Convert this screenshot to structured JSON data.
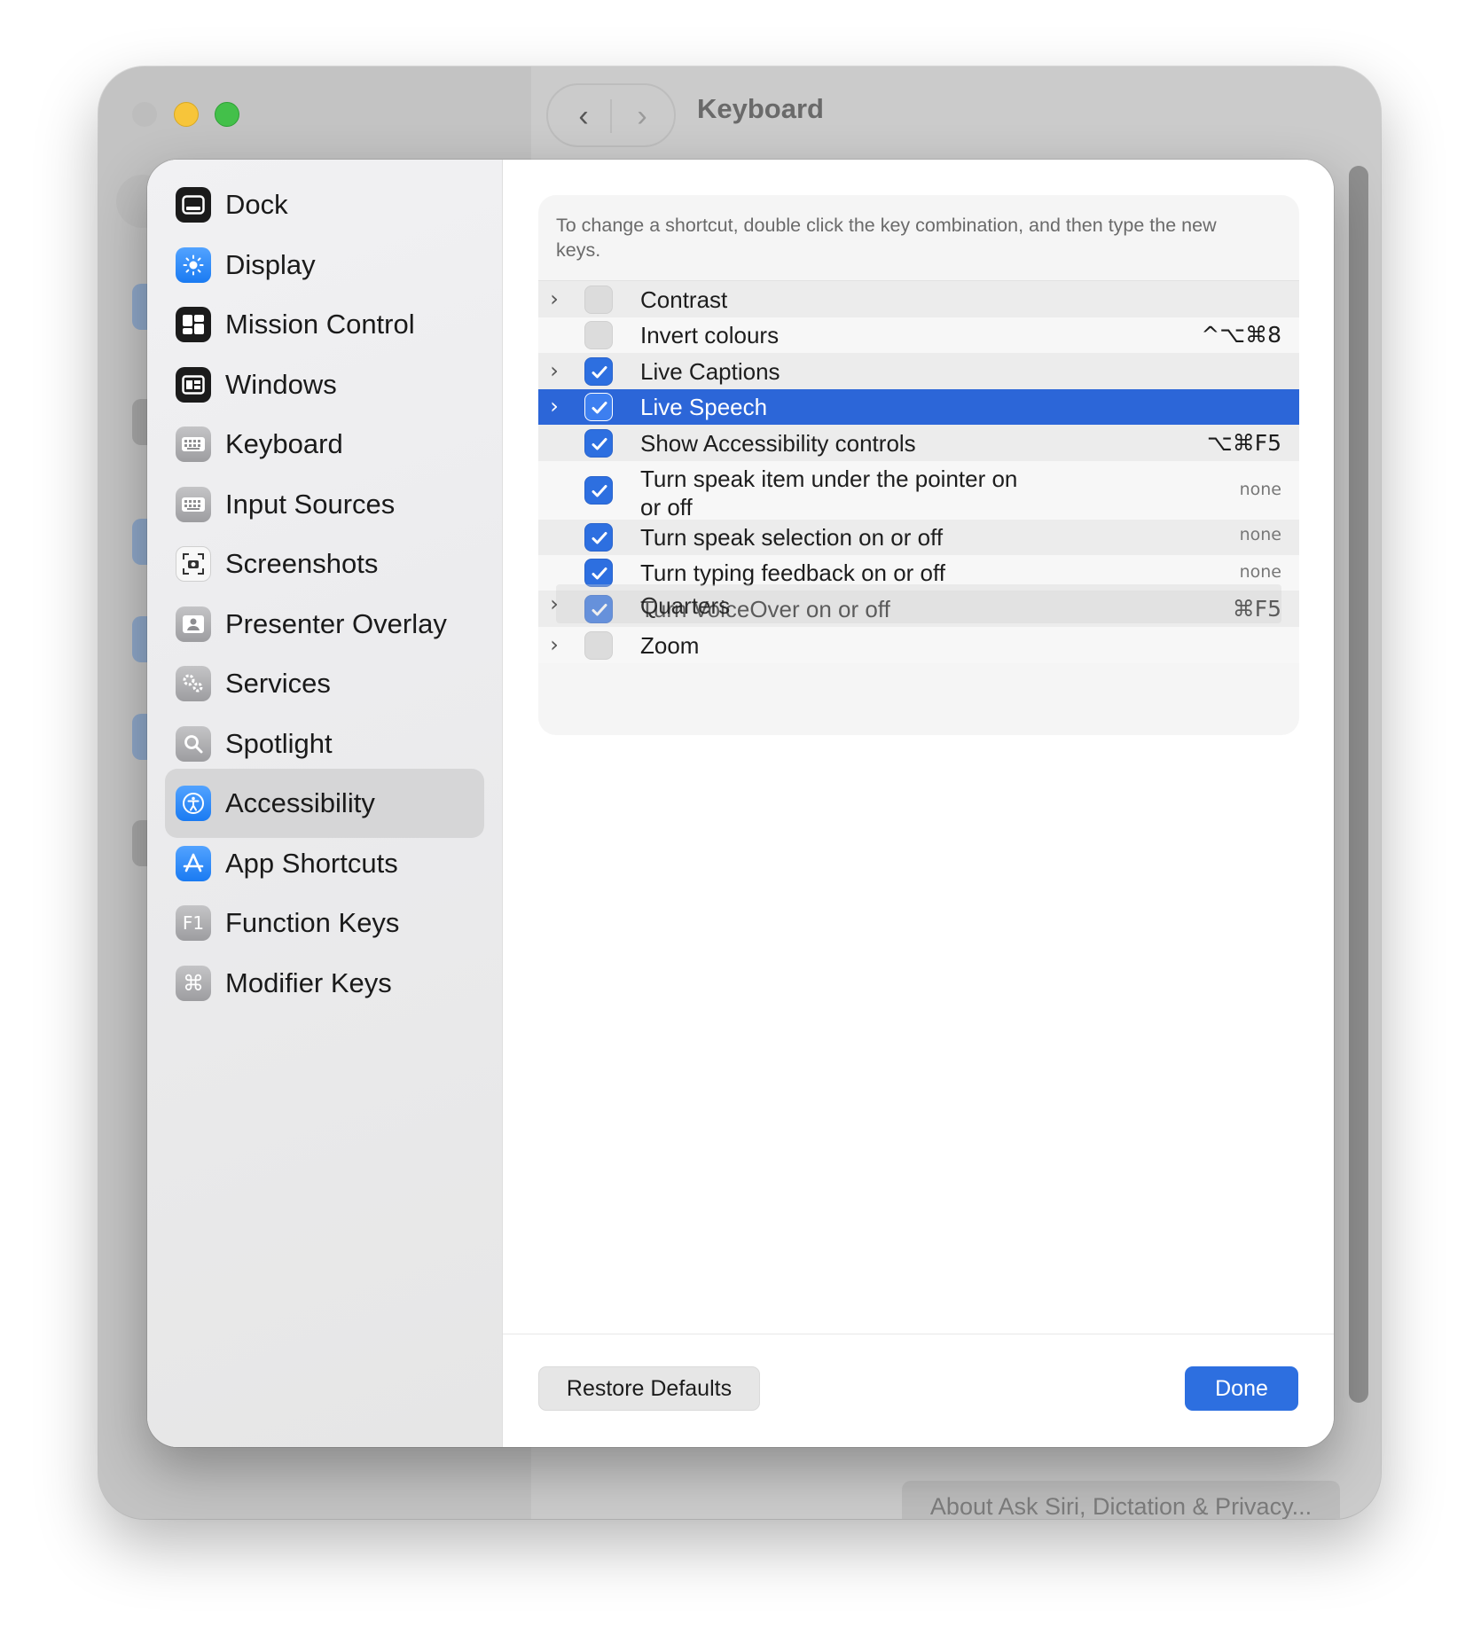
{
  "window": {
    "title": "Keyboard",
    "nav_back": "‹",
    "nav_forward": "›",
    "footer_link": "About Ask Siri, Dictation & Privacy..."
  },
  "sidebar": {
    "items": [
      {
        "label": "Dock",
        "icon": "dock-icon"
      },
      {
        "label": "Display",
        "icon": "display-icon"
      },
      {
        "label": "Mission Control",
        "icon": "mission-control-icon"
      },
      {
        "label": "Windows",
        "icon": "windows-icon"
      },
      {
        "label": "Keyboard",
        "icon": "keyboard-icon"
      },
      {
        "label": "Input Sources",
        "icon": "input-sources-icon"
      },
      {
        "label": "Screenshots",
        "icon": "screenshots-icon"
      },
      {
        "label": "Presenter Overlay",
        "icon": "presenter-overlay-icon"
      },
      {
        "label": "Services",
        "icon": "services-icon"
      },
      {
        "label": "Spotlight",
        "icon": "spotlight-icon"
      },
      {
        "label": "Accessibility",
        "icon": "accessibility-icon",
        "selected": true
      },
      {
        "label": "App Shortcuts",
        "icon": "app-shortcuts-icon"
      },
      {
        "label": "Function Keys",
        "icon": "function-keys-icon",
        "glyph": "F1"
      },
      {
        "label": "Modifier Keys",
        "icon": "modifier-keys-icon",
        "glyph": "⌘"
      }
    ]
  },
  "shortcuts": {
    "hint": "To change a shortcut, double click the key combination, and then type the new keys.",
    "rows": [
      {
        "label": "Contrast",
        "expandable": true,
        "checked": false,
        "shortcut": ""
      },
      {
        "label": "Invert colours",
        "expandable": false,
        "checked": false,
        "shortcut": "^⌥⌘8"
      },
      {
        "label": "Live Captions",
        "expandable": true,
        "checked": true,
        "shortcut": ""
      },
      {
        "label": "Live Speech",
        "expandable": true,
        "checked": true,
        "shortcut": "",
        "selected": true
      },
      {
        "label": "Show Accessibility controls",
        "expandable": false,
        "checked": true,
        "shortcut": "⌥⌘F5"
      },
      {
        "label": "Turn speak item under the pointer on",
        "label_line2": "or off",
        "expandable": false,
        "checked": true,
        "shortcut": "none"
      },
      {
        "label": "Turn speak selection on or off",
        "expandable": false,
        "checked": true,
        "shortcut": "none"
      },
      {
        "label": "Turn typing feedback on or off",
        "expandable": false,
        "checked": true,
        "shortcut": "none"
      },
      {
        "label": "Turn VoiceOver on or off",
        "expandable": false,
        "checked": true,
        "shortcut": "⌘F5"
      },
      {
        "label": "Zoom",
        "expandable": true,
        "checked": false,
        "shortcut": ""
      }
    ],
    "drag_ghost": {
      "label": "Quarters",
      "chevron": "›"
    }
  },
  "footer": {
    "restore_label": "Restore Defaults",
    "done_label": "Done"
  },
  "colors": {
    "accent": "#2d6fe0",
    "selection": "#2c66d8"
  }
}
